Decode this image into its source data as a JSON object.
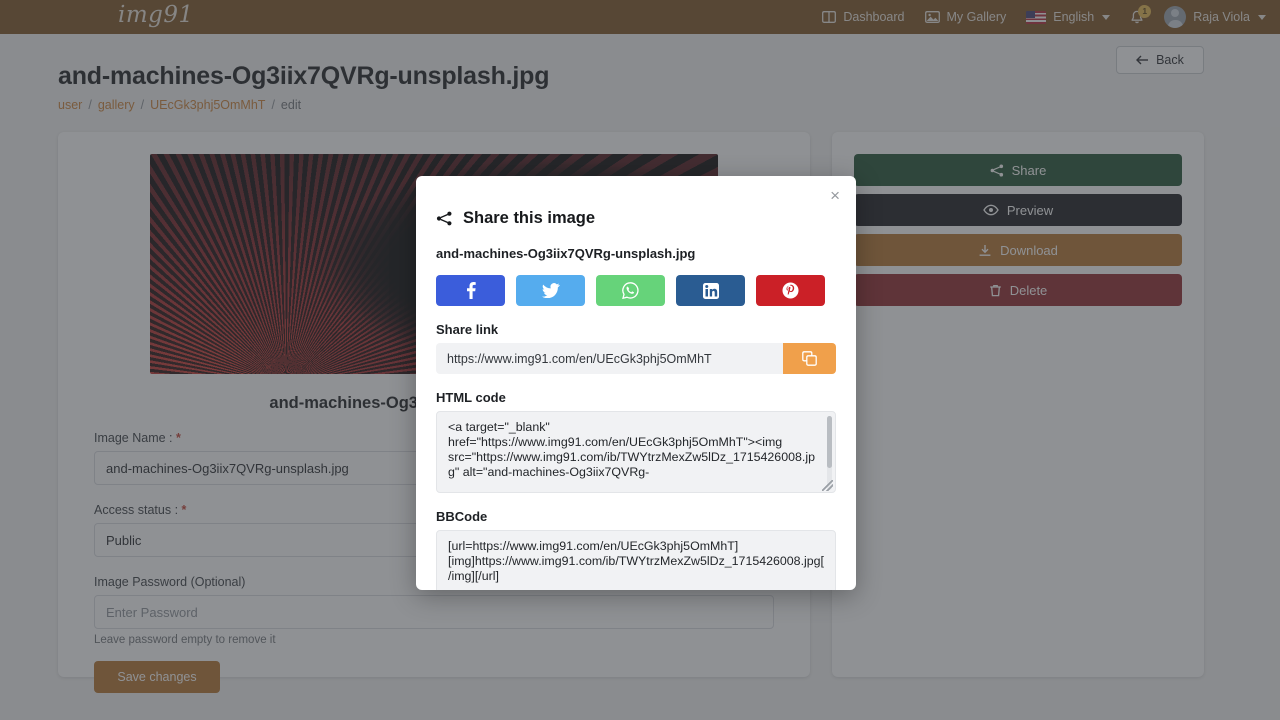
{
  "navbar": {
    "brand": "img91",
    "dashboard": "Dashboard",
    "my_gallery": "My Gallery",
    "language": "English",
    "notification_count": "1",
    "user_name": "Raja Viola"
  },
  "header": {
    "title": "and-machines-Og3iix7QVRg-unsplash.jpg",
    "breadcrumb": {
      "user": "user",
      "gallery": "gallery",
      "id": "UEcGk3phj5OmMhT",
      "current": "edit",
      "sep": "/"
    },
    "back_label": "Back"
  },
  "left_panel": {
    "file_caption": "and-machines-Og3iix7QVRg-unsplash.jpg",
    "image_name_label": "Image Name :",
    "image_name_value": "and-machines-Og3iix7QVRg-unsplash.jpg",
    "access_status_label": "Access status :",
    "access_status_value": "Public",
    "password_label": "Image Password (Optional)",
    "password_placeholder": "Enter Password",
    "password_hint": "Leave password empty to remove it",
    "save_label": "Save changes",
    "required_mark": "*"
  },
  "actions": {
    "share": "Share",
    "preview": "Preview",
    "download": "Download",
    "delete": "Delete"
  },
  "modal": {
    "title": "Share this image",
    "close": "×",
    "filename": "and-machines-Og3iix7QVRg-unsplash.jpg",
    "socials": [
      {
        "name": "facebook"
      },
      {
        "name": "twitter"
      },
      {
        "name": "whatsapp"
      },
      {
        "name": "linkedin"
      },
      {
        "name": "pinterest"
      }
    ],
    "share_link_label": "Share link",
    "share_link_value": "https://www.img91.com/en/UEcGk3phj5OmMhT",
    "html_code_label": "HTML code",
    "html_code_value": "<a target=\"_blank\" href=\"https://www.img91.com/en/UEcGk3phj5OmMhT\"><img src=\"https://www.img91.com/ib/TWYtrzMexZw5lDz_1715426008.jpg\" alt=\"and-machines-Og3iix7QVRg-",
    "bbcode_label": "BBCode",
    "bbcode_value": "[url=https://www.img91.com/en/UEcGk3phj5OmMhT][img]https://www.img91.com/ib/TWYtrzMexZw5lDz_1715426008.jpg[/img][/url]"
  },
  "colors": {
    "navbar": "#7a4f1d",
    "accent_orange": "#cd7f32",
    "share_green": "#1b4d2e",
    "preview_black": "#131518",
    "download_amber": "#b4712a",
    "delete_red": "#8e2226",
    "copy_orange": "#f0a04b"
  }
}
